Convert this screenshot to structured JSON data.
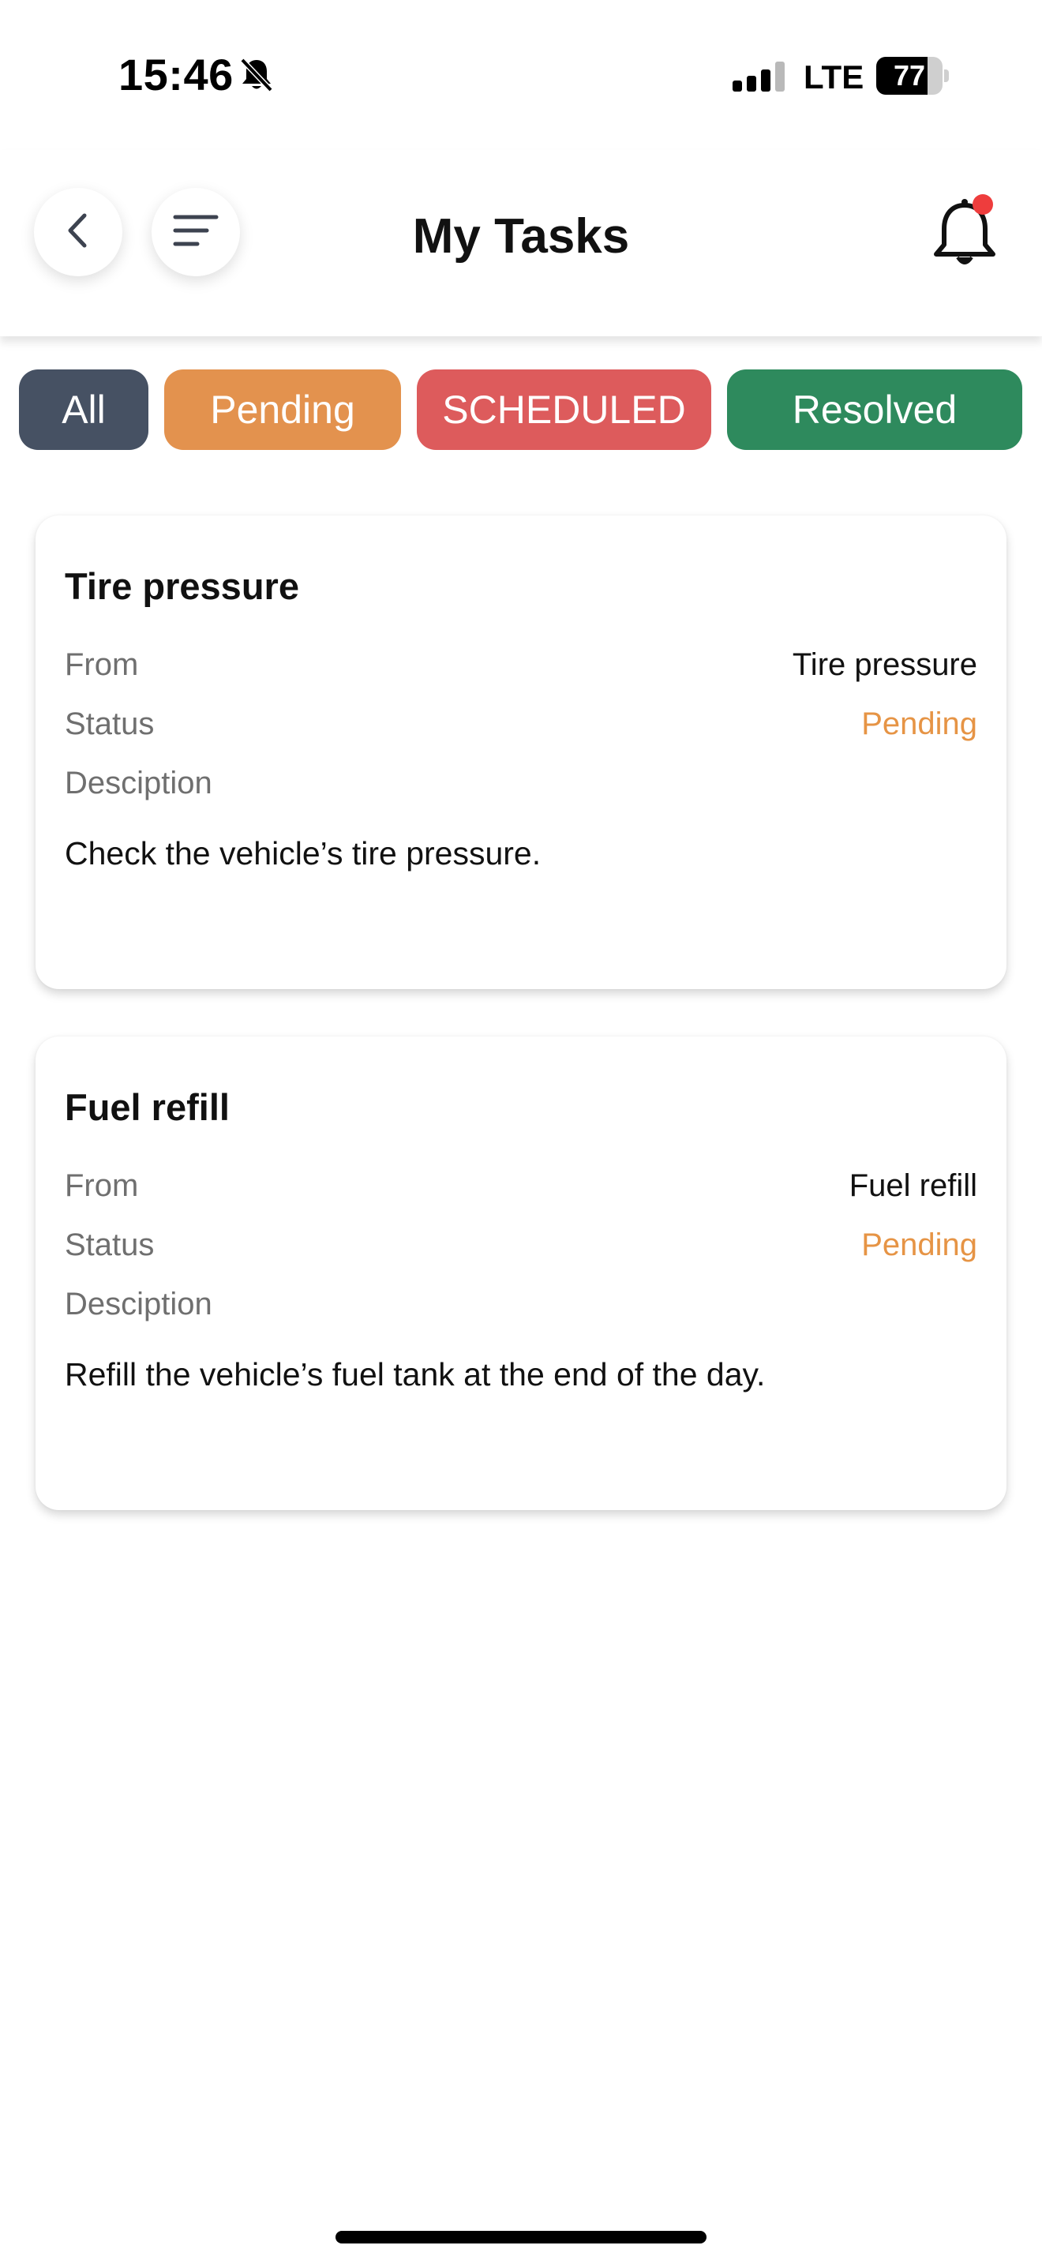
{
  "status_bar": {
    "time": "15:46",
    "network": "LTE",
    "battery": "77",
    "battery_level": 0.77,
    "icons": [
      "bell-slash-icon",
      "signal-icon"
    ]
  },
  "header": {
    "title": "My Tasks",
    "back_icon": "chevron-left-icon",
    "menu_icon": "hamburger-menu-icon",
    "notification_icon": "bell-icon",
    "notification_badge": true
  },
  "filters": [
    {
      "label": "All",
      "color": "#465163"
    },
    {
      "label": "Pending",
      "color": "#e3924e"
    },
    {
      "label": "SCHEDULED",
      "color": "#dd5b5c"
    },
    {
      "label": "Resolved",
      "color": "#2e8a5d"
    }
  ],
  "tasks": [
    {
      "title": "Tire pressure",
      "from_label": "From",
      "from_value": "Tire pressure",
      "status_label": "Status",
      "status_value": "Pending",
      "description_label": "Desciption",
      "description": "Check the vehicle’s tire pressure."
    },
    {
      "title": "Fuel refill",
      "from_label": "From",
      "from_value": "Fuel refill",
      "status_label": "Status",
      "status_value": "Pending",
      "description_label": "Desciption",
      "description": "Refill the vehicle’s fuel tank at the end of the day."
    }
  ],
  "colors": {
    "pending_text": "#e69445",
    "notification_dot": "#ee3d3d"
  }
}
